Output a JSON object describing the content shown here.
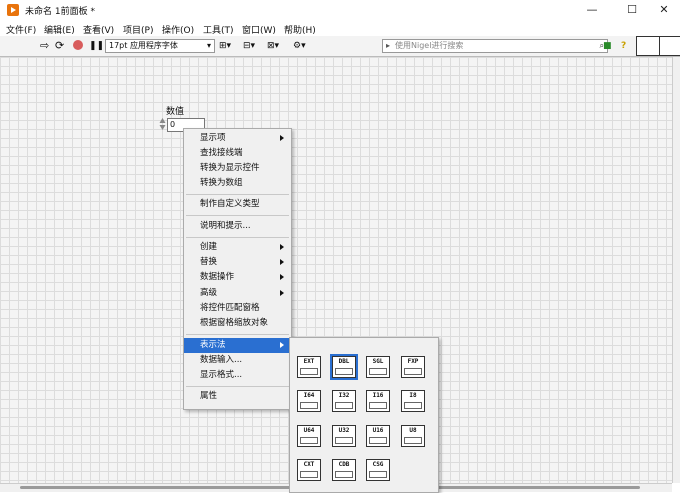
{
  "title": "未命名 1前面板 *",
  "window_controls": {
    "minimize": "—",
    "maximize": "☐",
    "close": "✕"
  },
  "menu": [
    "文件(F)",
    "编辑(E)",
    "查看(V)",
    "项目(P)",
    "操作(O)",
    "工具(T)",
    "窗口(W)",
    "帮助(H)"
  ],
  "toolbar": {
    "font": "17pt 应用程序字体",
    "search_placeholder": "使用Nigel进行搜索",
    "help_icon": "?"
  },
  "control": {
    "label": "数值",
    "value": "0"
  },
  "context_menu": {
    "items": [
      {
        "label": "显示项",
        "submenu": true
      },
      {
        "label": "查找接线端",
        "submenu": false
      },
      {
        "label": "转换为显示控件",
        "submenu": false
      },
      {
        "label": "转换为数组",
        "submenu": false
      },
      {
        "label": "制作自定义类型",
        "submenu": false
      },
      {
        "label": "说明和提示...",
        "submenu": false
      },
      {
        "label": "创建",
        "submenu": true
      },
      {
        "label": "替换",
        "submenu": true
      },
      {
        "label": "数据操作",
        "submenu": true
      },
      {
        "label": "高级",
        "submenu": true
      },
      {
        "label": "将控件匹配窗格",
        "submenu": false
      },
      {
        "label": "根据窗格缩放对象",
        "submenu": false
      },
      {
        "label": "表示法",
        "submenu": true,
        "selected": true
      },
      {
        "label": "数据输入...",
        "submenu": false
      },
      {
        "label": "显示格式...",
        "submenu": false
      },
      {
        "label": "属性",
        "submenu": false
      }
    ]
  },
  "representation_palette": {
    "items": [
      "EXT",
      "DBL",
      "SGL",
      "FXP",
      "I64",
      "I32",
      "I16",
      "I8",
      "U64",
      "U32",
      "U16",
      "U8",
      "CXT",
      "CDB",
      "CSG"
    ],
    "current": "DBL"
  },
  "colors": {
    "selection": "#2a6fd1",
    "app_icon": "#e8730c"
  }
}
